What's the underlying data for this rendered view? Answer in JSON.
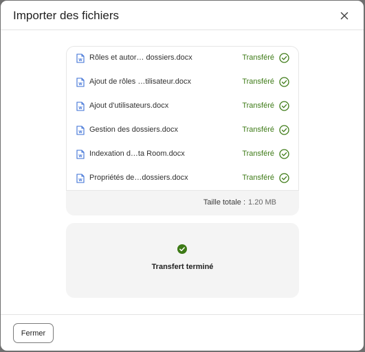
{
  "dialog": {
    "title": "Importer des fichiers",
    "close_icon": "close-icon"
  },
  "files": [
    {
      "name": "Rôles et autor… dossiers.docx",
      "status": "Transféré"
    },
    {
      "name": "Ajout de rôles …tilisateur.docx",
      "status": "Transféré"
    },
    {
      "name": "Ajout d'utilisateurs.docx",
      "status": "Transféré"
    },
    {
      "name": "Gestion des dossiers.docx",
      "status": "Transféré"
    },
    {
      "name": "Indexation d…ta Room.docx",
      "status": "Transféré"
    },
    {
      "name": "Propriétés de…dossiers.docx",
      "status": "Transféré"
    }
  ],
  "summary": {
    "total_label": "Taille totale :",
    "total_value": "1.20 MB"
  },
  "transfer": {
    "status_label": "Transfert terminé",
    "icon": "check-circle-icon"
  },
  "footer": {
    "close_label": "Fermer"
  },
  "colors": {
    "success": "#3d7a16",
    "doc_icon": "#3b6fd6"
  }
}
